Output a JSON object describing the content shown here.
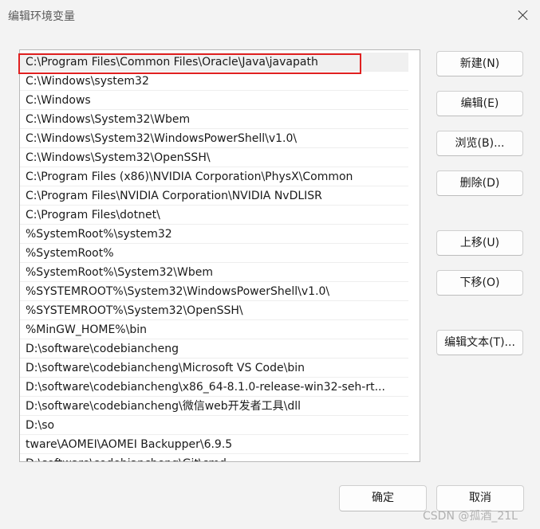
{
  "window": {
    "title": "编辑环境变量"
  },
  "list": {
    "items": [
      "C:\\Program Files\\Common Files\\Oracle\\Java\\javapath",
      "C:\\Windows\\system32",
      "C:\\Windows",
      "C:\\Windows\\System32\\Wbem",
      "C:\\Windows\\System32\\WindowsPowerShell\\v1.0\\",
      "C:\\Windows\\System32\\OpenSSH\\",
      "C:\\Program Files (x86)\\NVIDIA Corporation\\PhysX\\Common",
      "C:\\Program Files\\NVIDIA Corporation\\NVIDIA NvDLISR",
      "C:\\Program Files\\dotnet\\",
      "%SystemRoot%\\system32",
      "%SystemRoot%",
      "%SystemRoot%\\System32\\Wbem",
      "%SYSTEMROOT%\\System32\\WindowsPowerShell\\v1.0\\",
      "%SYSTEMROOT%\\System32\\OpenSSH\\",
      "%MinGW_HOME%\\bin",
      "D:\\software\\codebiancheng",
      "D:\\software\\codebiancheng\\Microsoft VS Code\\bin",
      "D:\\software\\codebiancheng\\x86_64-8.1.0-release-win32-seh-rt...",
      "D:\\software\\codebiancheng\\微信web开发者工具\\dll",
      "D:\\so",
      "tware\\AOMEI\\AOMEI Backupper\\6.9.5",
      "D:\\software\\codebiancheng\\Git\\cmd"
    ]
  },
  "buttons": {
    "new": "新建(N)",
    "edit": "编辑(E)",
    "browse": "浏览(B)...",
    "delete": "删除(D)",
    "move_up": "上移(U)",
    "move_down": "下移(O)",
    "edit_text": "编辑文本(T)...",
    "ok": "确定",
    "cancel": "取消"
  },
  "watermark": "CSDN @孤酒_21L",
  "colors": {
    "highlight_border": "#e02020",
    "background": "#f3f3f3"
  }
}
